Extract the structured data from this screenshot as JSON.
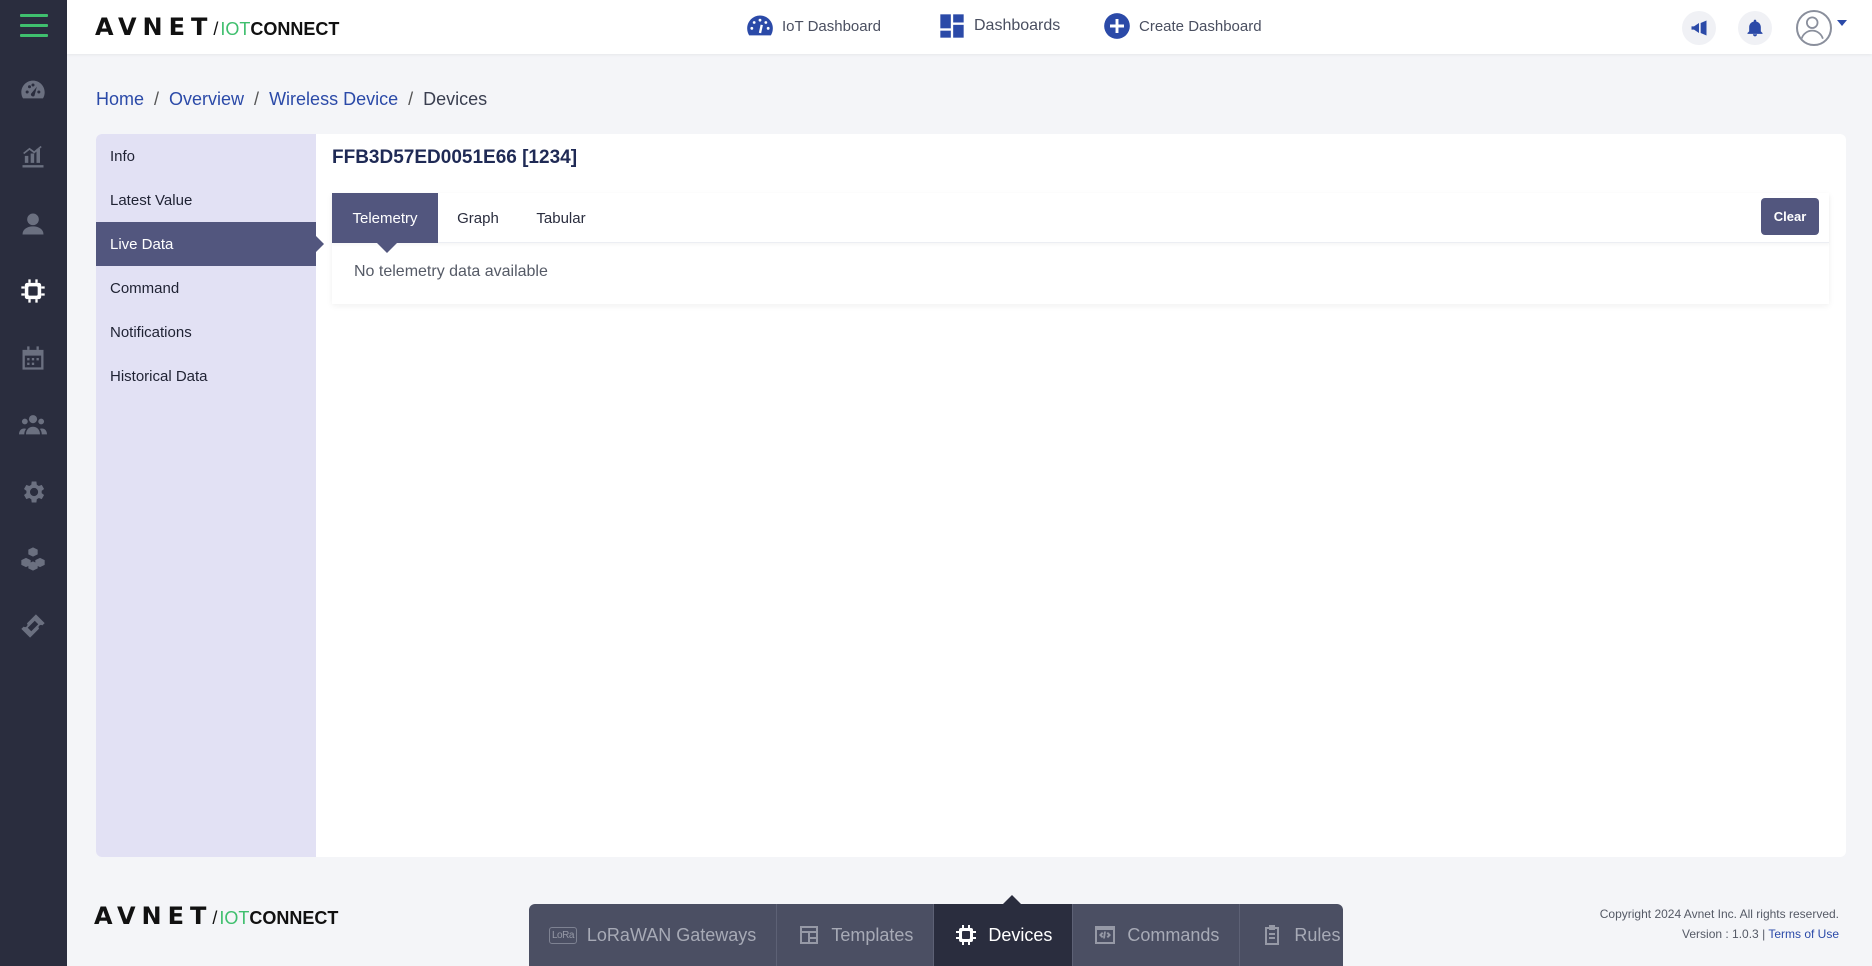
{
  "brand": {
    "avnet": "AVNET",
    "slash": "/",
    "iot": "IOT",
    "connect": "CONNECT"
  },
  "topnav": {
    "iot_dashboard": "IoT Dashboard",
    "dashboards": "Dashboards",
    "create_dashboard": "Create Dashboard"
  },
  "breadcrumb": {
    "home": "Home",
    "overview": "Overview",
    "wireless_device": "Wireless Device",
    "current": "Devices",
    "separator": "/"
  },
  "sidemenu": {
    "items": [
      {
        "label": "Info"
      },
      {
        "label": "Latest Value"
      },
      {
        "label": "Live Data",
        "active": true
      },
      {
        "label": "Command"
      },
      {
        "label": "Notifications"
      },
      {
        "label": "Historical Data"
      }
    ]
  },
  "device": {
    "title": "FFB3D57ED0051E66 [1234]"
  },
  "tabs": {
    "telemetry": "Telemetry",
    "graph": "Graph",
    "tabular": "Tabular",
    "active": "Telemetry",
    "clear_label": "Clear"
  },
  "content": {
    "empty_message": "No telemetry data available"
  },
  "bottom_nav": {
    "lora_badge": "LoRa",
    "items": [
      {
        "label": "LoRaWAN Gateways",
        "icon": "lora-icon"
      },
      {
        "label": "Templates",
        "icon": "template-icon"
      },
      {
        "label": "Devices",
        "icon": "chip-icon",
        "active": true
      },
      {
        "label": "Commands",
        "icon": "code-window-icon"
      },
      {
        "label": "Rules",
        "icon": "clipboard-icon"
      }
    ]
  },
  "footer": {
    "copyright": "Copyright 2024 Avnet Inc. All rights reserved.",
    "version": "Version : 1.0.3 |",
    "terms": "Terms of Use"
  },
  "colors": {
    "rail_bg": "#2a2d3e",
    "accent_green": "#3fbf6e",
    "accent_purple": "#52567e",
    "link_blue": "#2b4aa8",
    "sidemenu_bg": "#e2e1f4"
  }
}
